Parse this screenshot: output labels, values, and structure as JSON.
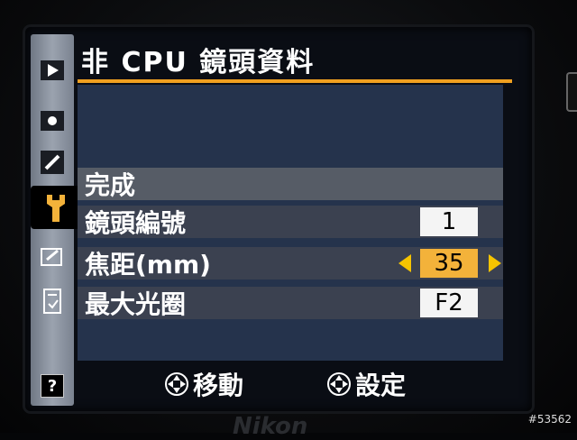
{
  "menu": {
    "title": "非 CPU 鏡頭資料"
  },
  "rows": [
    {
      "label": "完成"
    },
    {
      "label": "鏡頭編號",
      "value": "1"
    },
    {
      "label": "焦距(mm)",
      "value": "35"
    },
    {
      "label": "最大光圈",
      "value": "F2"
    }
  ],
  "footer": {
    "move_label": "移動",
    "set_label": "設定"
  },
  "sidebar": {
    "icons": [
      "playback-icon",
      "shooting-icon",
      "custom-settings-pencil-icon",
      "setup-wrench-icon",
      "retouch-icon",
      "my-menu-icon"
    ],
    "help_label": "?"
  },
  "brand": "Nikon",
  "watermark": "#53562",
  "colors": {
    "accent_line": "#f0a020",
    "selected_value": "#f3b23a",
    "arrow": "#f6c400"
  }
}
